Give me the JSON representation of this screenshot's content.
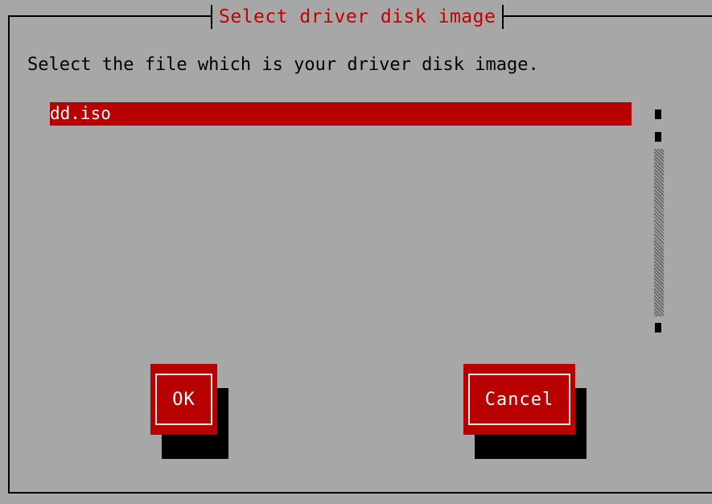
{
  "dialog": {
    "title": "Select driver disk image",
    "prompt": "Select the file which is your driver disk image."
  },
  "file_list": {
    "items": [
      {
        "label": "dd.iso",
        "selected": true
      }
    ]
  },
  "buttons": {
    "ok_label": "OK",
    "cancel_label": "Cancel"
  },
  "colors": {
    "background": "#a7a7a7",
    "accent": "#b90000",
    "title_text": "#c00000",
    "text": "#000000",
    "shadow": "#000000"
  }
}
